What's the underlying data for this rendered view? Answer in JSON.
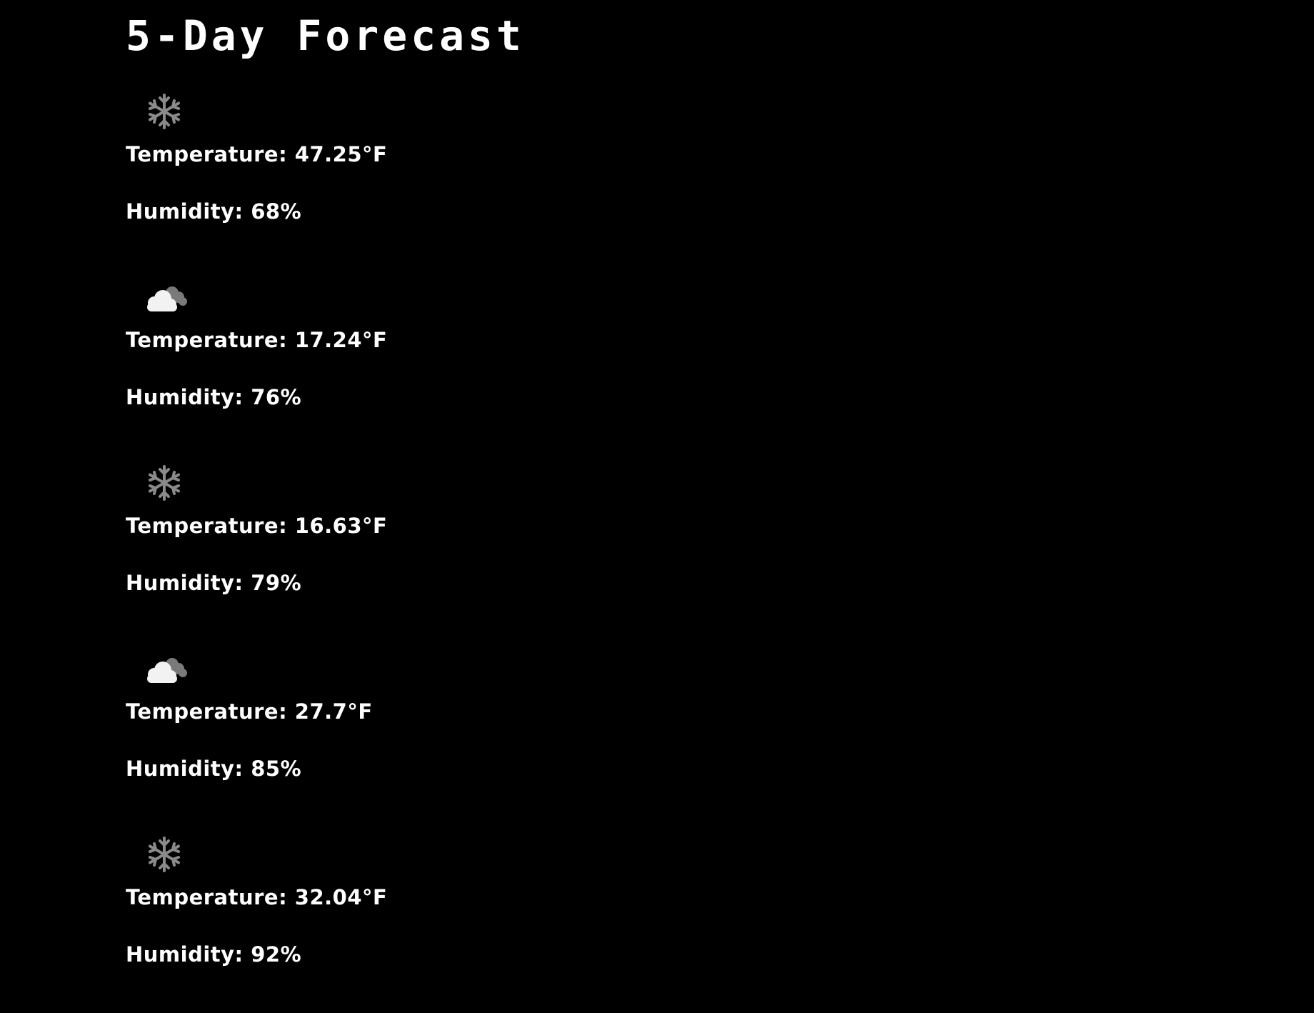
{
  "header": {
    "title": "5-Day Forecast"
  },
  "colors": {
    "background": "#000000",
    "text": "#ffffff",
    "snow_icon": "#8a8a8a",
    "cloud_front": "#f2f2f2",
    "cloud_back": "#7a7a7a"
  },
  "forecast": [
    {
      "icon": "snowflake-icon",
      "temperature_text": "Temperature: 47.25°F",
      "humidity_text": "Humidity: 68%"
    },
    {
      "icon": "cloud-icon",
      "temperature_text": "Temperature: 17.24°F",
      "humidity_text": "Humidity: 76%"
    },
    {
      "icon": "snowflake-icon",
      "temperature_text": "Temperature: 16.63°F",
      "humidity_text": "Humidity: 79%"
    },
    {
      "icon": "cloud-icon",
      "temperature_text": "Temperature: 27.7°F",
      "humidity_text": "Humidity: 85%"
    },
    {
      "icon": "snowflake-icon",
      "temperature_text": "Temperature: 32.04°F",
      "humidity_text": "Humidity: 92%"
    }
  ]
}
